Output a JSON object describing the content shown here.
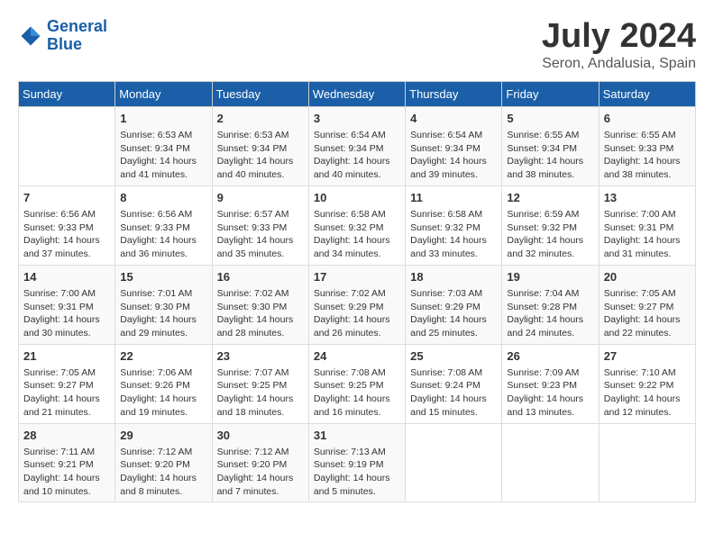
{
  "header": {
    "logo_line1": "General",
    "logo_line2": "Blue",
    "title": "July 2024",
    "subtitle": "Seron, Andalusia, Spain"
  },
  "calendar": {
    "days_of_week": [
      "Sunday",
      "Monday",
      "Tuesday",
      "Wednesday",
      "Thursday",
      "Friday",
      "Saturday"
    ],
    "weeks": [
      [
        {
          "day": "",
          "content": ""
        },
        {
          "day": "1",
          "content": "Sunrise: 6:53 AM\nSunset: 9:34 PM\nDaylight: 14 hours\nand 41 minutes."
        },
        {
          "day": "2",
          "content": "Sunrise: 6:53 AM\nSunset: 9:34 PM\nDaylight: 14 hours\nand 40 minutes."
        },
        {
          "day": "3",
          "content": "Sunrise: 6:54 AM\nSunset: 9:34 PM\nDaylight: 14 hours\nand 40 minutes."
        },
        {
          "day": "4",
          "content": "Sunrise: 6:54 AM\nSunset: 9:34 PM\nDaylight: 14 hours\nand 39 minutes."
        },
        {
          "day": "5",
          "content": "Sunrise: 6:55 AM\nSunset: 9:34 PM\nDaylight: 14 hours\nand 38 minutes."
        },
        {
          "day": "6",
          "content": "Sunrise: 6:55 AM\nSunset: 9:33 PM\nDaylight: 14 hours\nand 38 minutes."
        }
      ],
      [
        {
          "day": "7",
          "content": "Sunrise: 6:56 AM\nSunset: 9:33 PM\nDaylight: 14 hours\nand 37 minutes."
        },
        {
          "day": "8",
          "content": "Sunrise: 6:56 AM\nSunset: 9:33 PM\nDaylight: 14 hours\nand 36 minutes."
        },
        {
          "day": "9",
          "content": "Sunrise: 6:57 AM\nSunset: 9:33 PM\nDaylight: 14 hours\nand 35 minutes."
        },
        {
          "day": "10",
          "content": "Sunrise: 6:58 AM\nSunset: 9:32 PM\nDaylight: 14 hours\nand 34 minutes."
        },
        {
          "day": "11",
          "content": "Sunrise: 6:58 AM\nSunset: 9:32 PM\nDaylight: 14 hours\nand 33 minutes."
        },
        {
          "day": "12",
          "content": "Sunrise: 6:59 AM\nSunset: 9:32 PM\nDaylight: 14 hours\nand 32 minutes."
        },
        {
          "day": "13",
          "content": "Sunrise: 7:00 AM\nSunset: 9:31 PM\nDaylight: 14 hours\nand 31 minutes."
        }
      ],
      [
        {
          "day": "14",
          "content": "Sunrise: 7:00 AM\nSunset: 9:31 PM\nDaylight: 14 hours\nand 30 minutes."
        },
        {
          "day": "15",
          "content": "Sunrise: 7:01 AM\nSunset: 9:30 PM\nDaylight: 14 hours\nand 29 minutes."
        },
        {
          "day": "16",
          "content": "Sunrise: 7:02 AM\nSunset: 9:30 PM\nDaylight: 14 hours\nand 28 minutes."
        },
        {
          "day": "17",
          "content": "Sunrise: 7:02 AM\nSunset: 9:29 PM\nDaylight: 14 hours\nand 26 minutes."
        },
        {
          "day": "18",
          "content": "Sunrise: 7:03 AM\nSunset: 9:29 PM\nDaylight: 14 hours\nand 25 minutes."
        },
        {
          "day": "19",
          "content": "Sunrise: 7:04 AM\nSunset: 9:28 PM\nDaylight: 14 hours\nand 24 minutes."
        },
        {
          "day": "20",
          "content": "Sunrise: 7:05 AM\nSunset: 9:27 PM\nDaylight: 14 hours\nand 22 minutes."
        }
      ],
      [
        {
          "day": "21",
          "content": "Sunrise: 7:05 AM\nSunset: 9:27 PM\nDaylight: 14 hours\nand 21 minutes."
        },
        {
          "day": "22",
          "content": "Sunrise: 7:06 AM\nSunset: 9:26 PM\nDaylight: 14 hours\nand 19 minutes."
        },
        {
          "day": "23",
          "content": "Sunrise: 7:07 AM\nSunset: 9:25 PM\nDaylight: 14 hours\nand 18 minutes."
        },
        {
          "day": "24",
          "content": "Sunrise: 7:08 AM\nSunset: 9:25 PM\nDaylight: 14 hours\nand 16 minutes."
        },
        {
          "day": "25",
          "content": "Sunrise: 7:08 AM\nSunset: 9:24 PM\nDaylight: 14 hours\nand 15 minutes."
        },
        {
          "day": "26",
          "content": "Sunrise: 7:09 AM\nSunset: 9:23 PM\nDaylight: 14 hours\nand 13 minutes."
        },
        {
          "day": "27",
          "content": "Sunrise: 7:10 AM\nSunset: 9:22 PM\nDaylight: 14 hours\nand 12 minutes."
        }
      ],
      [
        {
          "day": "28",
          "content": "Sunrise: 7:11 AM\nSunset: 9:21 PM\nDaylight: 14 hours\nand 10 minutes."
        },
        {
          "day": "29",
          "content": "Sunrise: 7:12 AM\nSunset: 9:20 PM\nDaylight: 14 hours\nand 8 minutes."
        },
        {
          "day": "30",
          "content": "Sunrise: 7:12 AM\nSunset: 9:20 PM\nDaylight: 14 hours\nand 7 minutes."
        },
        {
          "day": "31",
          "content": "Sunrise: 7:13 AM\nSunset: 9:19 PM\nDaylight: 14 hours\nand 5 minutes."
        },
        {
          "day": "",
          "content": ""
        },
        {
          "day": "",
          "content": ""
        },
        {
          "day": "",
          "content": ""
        }
      ]
    ]
  }
}
